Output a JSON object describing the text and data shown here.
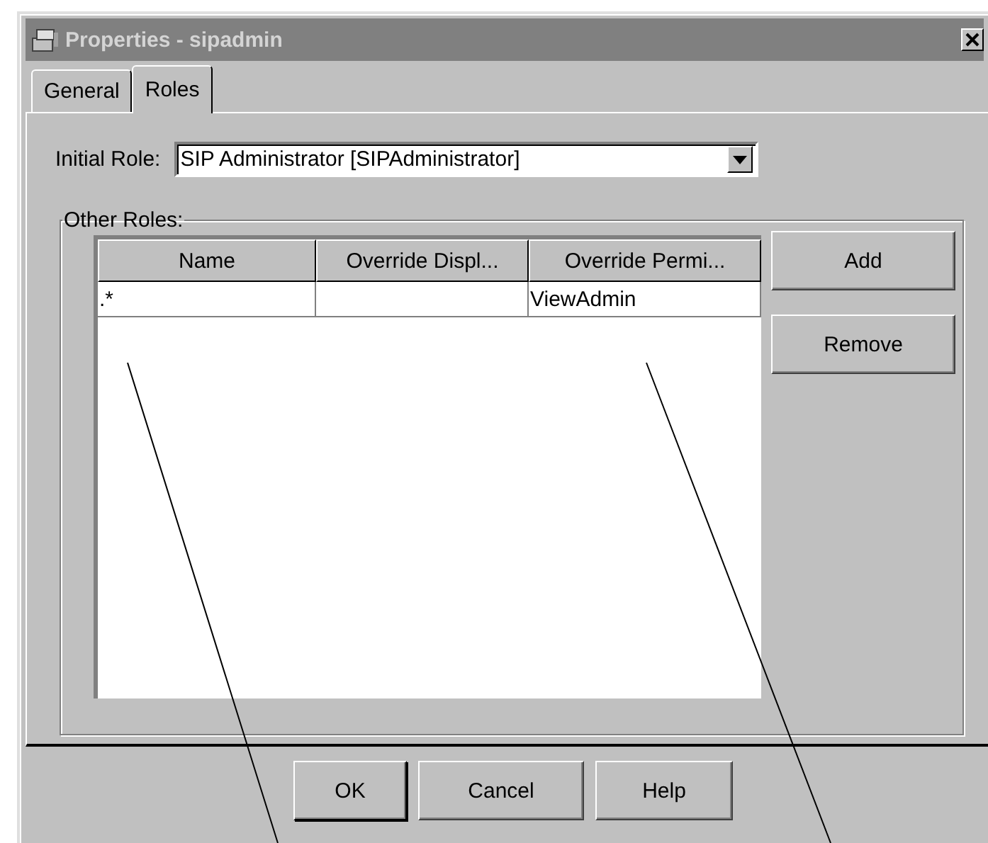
{
  "window": {
    "title": "Properties - sipadmin"
  },
  "tabs": [
    {
      "label": "General",
      "selected": false
    },
    {
      "label": "Roles",
      "selected": true
    }
  ],
  "initial_role": {
    "label": "Initial Role:",
    "value": "SIP Administrator [SIPAdministrator]"
  },
  "other_roles": {
    "title": "Other Roles:",
    "columns": [
      "Name",
      "Override Displ...",
      "Override Permi..."
    ],
    "rows": [
      {
        "cells": [
          ".*",
          null,
          "ViewAdmin"
        ]
      }
    ],
    "buttons": [
      "Add",
      "Remove"
    ]
  },
  "buttons": [
    {
      "label": "OK",
      "default": true
    },
    {
      "label": "Cancel",
      "default": false
    },
    {
      "label": "Help",
      "default": false
    }
  ]
}
